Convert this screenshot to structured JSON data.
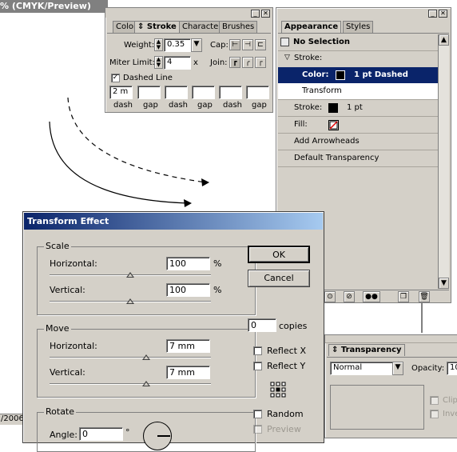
{
  "doc": {
    "title_fragment": "% (CMYK/Preview)",
    "status_fragment": "/2006"
  },
  "stroke_panel": {
    "tabs": [
      "Color",
      "Stroke",
      "Character",
      "Brushes"
    ],
    "weight_label": "Weight:",
    "weight_value": "0.35",
    "cap_label": "Cap:",
    "miter_label": "Miter Limit:",
    "miter_value": "4",
    "miter_unit": "x",
    "join_label": "Join:",
    "dashed_label": "Dashed Line",
    "dashed_checked": "✓",
    "dash_values": [
      "2 m",
      "",
      "",
      "",
      "",
      ""
    ],
    "dash_labels": [
      "dash",
      "gap",
      "dash",
      "gap",
      "dash",
      "gap"
    ]
  },
  "appearance_panel": {
    "tabs": [
      "Appearance",
      "Styles"
    ],
    "no_selection": "No Selection",
    "stroke_header": "Stroke:",
    "color_label": "Color:",
    "color_value": "1 pt Dashed",
    "transform": "Transform",
    "stroke_label": "Stroke:",
    "stroke_value": "1 pt",
    "fill_label": "Fill:",
    "add_arrowheads": "Add Arrowheads",
    "default_transparency": "Default Transparency"
  },
  "transparency_panel": {
    "tab": "Transparency",
    "mode": "Normal",
    "opacity_label": "Opacity:",
    "opacity_value": "10",
    "clip_label": "Clip",
    "invert_label": "Inve"
  },
  "dialog": {
    "title": "Transform Effect",
    "scale": {
      "label": "Scale",
      "horizontal_label": "Horizontal:",
      "horizontal_value": "100",
      "vertical_label": "Vertical:",
      "vertical_value": "100",
      "unit": "%"
    },
    "move": {
      "label": "Move",
      "horizontal_label": "Horizontal:",
      "horizontal_value": "7 mm",
      "vertical_label": "Vertical:",
      "vertical_value": "7 mm"
    },
    "rotate": {
      "label": "Rotate",
      "angle_label": "Angle:",
      "angle_value": "0",
      "angle_unit": "°"
    },
    "ok": "OK",
    "cancel": "Cancel",
    "copies_value": "0",
    "copies_label": "copies",
    "reflect_x": "Reflect X",
    "reflect_y": "Reflect Y",
    "random": "Random",
    "preview": "Preview"
  }
}
